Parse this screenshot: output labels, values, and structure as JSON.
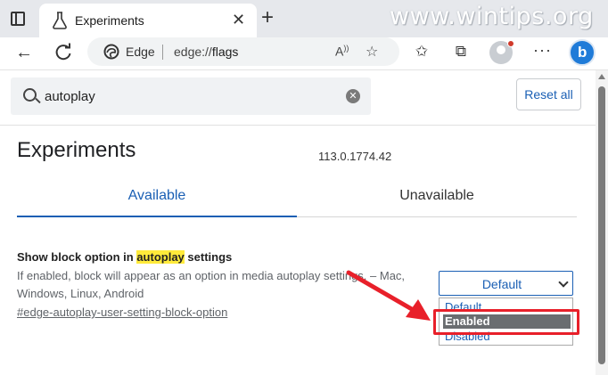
{
  "browser": {
    "tab_title": "Experiments",
    "tab_close": "✕",
    "new_tab": "+",
    "watermark": "www.wintips.org",
    "omnibox": {
      "brand_label": "Edge",
      "url_scheme": "edge://",
      "url_path": "flags"
    },
    "toolbar_icons": [
      "read-aloud-icon",
      "add-favorite-icon",
      "favorites-icon",
      "collections-icon",
      "profile-icon",
      "more-icon",
      "bing-icon"
    ],
    "bing_letter": "b"
  },
  "search": {
    "value": "autoplay",
    "clear": "✕",
    "reset_label": "Reset all"
  },
  "page": {
    "title": "Experiments",
    "version": "113.0.1774.42",
    "tabs": [
      {
        "label": "Available",
        "selected": true
      },
      {
        "label": "Unavailable",
        "selected": false
      }
    ]
  },
  "flag": {
    "title_before": "Show block option in ",
    "title_highlight": "autoplay",
    "title_after": " settings",
    "description": "If enabled, block will appear as an option in media autoplay settings. – Mac, Windows, Linux, Android",
    "link": "#edge-autoplay-user-setting-block-option",
    "select_value": "Default",
    "options": [
      "Default",
      "Enabled",
      "Disabled"
    ],
    "highlighted_option": "Enabled"
  },
  "colors": {
    "accent": "#1a5fb4",
    "annotation_red": "#e8202a",
    "highlight_yellow": "#ffeb3b"
  }
}
